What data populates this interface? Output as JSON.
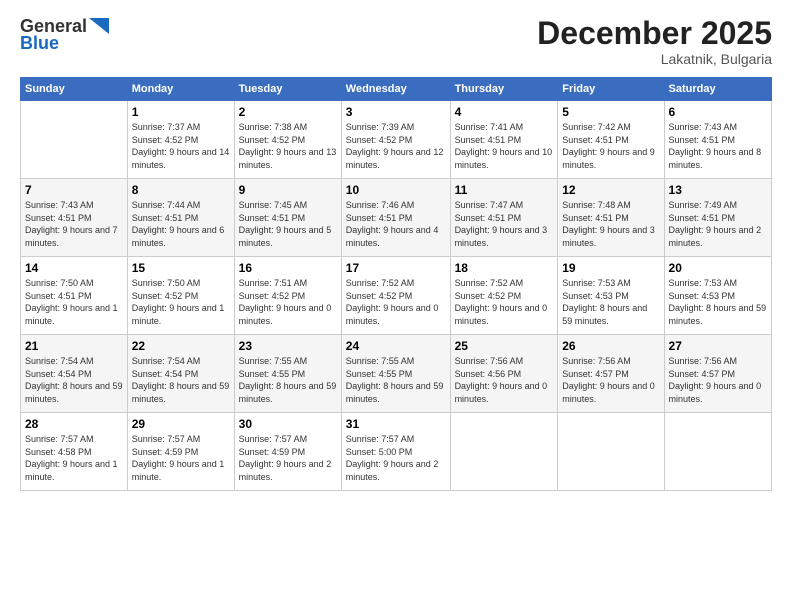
{
  "logo": {
    "general": "General",
    "blue": "Blue"
  },
  "header": {
    "title": "December 2025",
    "location": "Lakatnik, Bulgaria"
  },
  "days_of_week": [
    "Sunday",
    "Monday",
    "Tuesday",
    "Wednesday",
    "Thursday",
    "Friday",
    "Saturday"
  ],
  "weeks": [
    [
      {
        "day": "",
        "sunrise": "",
        "sunset": "",
        "daylight": ""
      },
      {
        "day": "1",
        "sunrise": "Sunrise: 7:37 AM",
        "sunset": "Sunset: 4:52 PM",
        "daylight": "Daylight: 9 hours and 14 minutes."
      },
      {
        "day": "2",
        "sunrise": "Sunrise: 7:38 AM",
        "sunset": "Sunset: 4:52 PM",
        "daylight": "Daylight: 9 hours and 13 minutes."
      },
      {
        "day": "3",
        "sunrise": "Sunrise: 7:39 AM",
        "sunset": "Sunset: 4:52 PM",
        "daylight": "Daylight: 9 hours and 12 minutes."
      },
      {
        "day": "4",
        "sunrise": "Sunrise: 7:41 AM",
        "sunset": "Sunset: 4:51 PM",
        "daylight": "Daylight: 9 hours and 10 minutes."
      },
      {
        "day": "5",
        "sunrise": "Sunrise: 7:42 AM",
        "sunset": "Sunset: 4:51 PM",
        "daylight": "Daylight: 9 hours and 9 minutes."
      },
      {
        "day": "6",
        "sunrise": "Sunrise: 7:43 AM",
        "sunset": "Sunset: 4:51 PM",
        "daylight": "Daylight: 9 hours and 8 minutes."
      }
    ],
    [
      {
        "day": "7",
        "sunrise": "Sunrise: 7:43 AM",
        "sunset": "Sunset: 4:51 PM",
        "daylight": "Daylight: 9 hours and 7 minutes."
      },
      {
        "day": "8",
        "sunrise": "Sunrise: 7:44 AM",
        "sunset": "Sunset: 4:51 PM",
        "daylight": "Daylight: 9 hours and 6 minutes."
      },
      {
        "day": "9",
        "sunrise": "Sunrise: 7:45 AM",
        "sunset": "Sunset: 4:51 PM",
        "daylight": "Daylight: 9 hours and 5 minutes."
      },
      {
        "day": "10",
        "sunrise": "Sunrise: 7:46 AM",
        "sunset": "Sunset: 4:51 PM",
        "daylight": "Daylight: 9 hours and 4 minutes."
      },
      {
        "day": "11",
        "sunrise": "Sunrise: 7:47 AM",
        "sunset": "Sunset: 4:51 PM",
        "daylight": "Daylight: 9 hours and 3 minutes."
      },
      {
        "day": "12",
        "sunrise": "Sunrise: 7:48 AM",
        "sunset": "Sunset: 4:51 PM",
        "daylight": "Daylight: 9 hours and 3 minutes."
      },
      {
        "day": "13",
        "sunrise": "Sunrise: 7:49 AM",
        "sunset": "Sunset: 4:51 PM",
        "daylight": "Daylight: 9 hours and 2 minutes."
      }
    ],
    [
      {
        "day": "14",
        "sunrise": "Sunrise: 7:50 AM",
        "sunset": "Sunset: 4:51 PM",
        "daylight": "Daylight: 9 hours and 1 minute."
      },
      {
        "day": "15",
        "sunrise": "Sunrise: 7:50 AM",
        "sunset": "Sunset: 4:52 PM",
        "daylight": "Daylight: 9 hours and 1 minute."
      },
      {
        "day": "16",
        "sunrise": "Sunrise: 7:51 AM",
        "sunset": "Sunset: 4:52 PM",
        "daylight": "Daylight: 9 hours and 0 minutes."
      },
      {
        "day": "17",
        "sunrise": "Sunrise: 7:52 AM",
        "sunset": "Sunset: 4:52 PM",
        "daylight": "Daylight: 9 hours and 0 minutes."
      },
      {
        "day": "18",
        "sunrise": "Sunrise: 7:52 AM",
        "sunset": "Sunset: 4:52 PM",
        "daylight": "Daylight: 9 hours and 0 minutes."
      },
      {
        "day": "19",
        "sunrise": "Sunrise: 7:53 AM",
        "sunset": "Sunset: 4:53 PM",
        "daylight": "Daylight: 8 hours and 59 minutes."
      },
      {
        "day": "20",
        "sunrise": "Sunrise: 7:53 AM",
        "sunset": "Sunset: 4:53 PM",
        "daylight": "Daylight: 8 hours and 59 minutes."
      }
    ],
    [
      {
        "day": "21",
        "sunrise": "Sunrise: 7:54 AM",
        "sunset": "Sunset: 4:54 PM",
        "daylight": "Daylight: 8 hours and 59 minutes."
      },
      {
        "day": "22",
        "sunrise": "Sunrise: 7:54 AM",
        "sunset": "Sunset: 4:54 PM",
        "daylight": "Daylight: 8 hours and 59 minutes."
      },
      {
        "day": "23",
        "sunrise": "Sunrise: 7:55 AM",
        "sunset": "Sunset: 4:55 PM",
        "daylight": "Daylight: 8 hours and 59 minutes."
      },
      {
        "day": "24",
        "sunrise": "Sunrise: 7:55 AM",
        "sunset": "Sunset: 4:55 PM",
        "daylight": "Daylight: 8 hours and 59 minutes."
      },
      {
        "day": "25",
        "sunrise": "Sunrise: 7:56 AM",
        "sunset": "Sunset: 4:56 PM",
        "daylight": "Daylight: 9 hours and 0 minutes."
      },
      {
        "day": "26",
        "sunrise": "Sunrise: 7:56 AM",
        "sunset": "Sunset: 4:57 PM",
        "daylight": "Daylight: 9 hours and 0 minutes."
      },
      {
        "day": "27",
        "sunrise": "Sunrise: 7:56 AM",
        "sunset": "Sunset: 4:57 PM",
        "daylight": "Daylight: 9 hours and 0 minutes."
      }
    ],
    [
      {
        "day": "28",
        "sunrise": "Sunrise: 7:57 AM",
        "sunset": "Sunset: 4:58 PM",
        "daylight": "Daylight: 9 hours and 1 minute."
      },
      {
        "day": "29",
        "sunrise": "Sunrise: 7:57 AM",
        "sunset": "Sunset: 4:59 PM",
        "daylight": "Daylight: 9 hours and 1 minute."
      },
      {
        "day": "30",
        "sunrise": "Sunrise: 7:57 AM",
        "sunset": "Sunset: 4:59 PM",
        "daylight": "Daylight: 9 hours and 2 minutes."
      },
      {
        "day": "31",
        "sunrise": "Sunrise: 7:57 AM",
        "sunset": "Sunset: 5:00 PM",
        "daylight": "Daylight: 9 hours and 2 minutes."
      },
      {
        "day": "",
        "sunrise": "",
        "sunset": "",
        "daylight": ""
      },
      {
        "day": "",
        "sunrise": "",
        "sunset": "",
        "daylight": ""
      },
      {
        "day": "",
        "sunrise": "",
        "sunset": "",
        "daylight": ""
      }
    ]
  ]
}
